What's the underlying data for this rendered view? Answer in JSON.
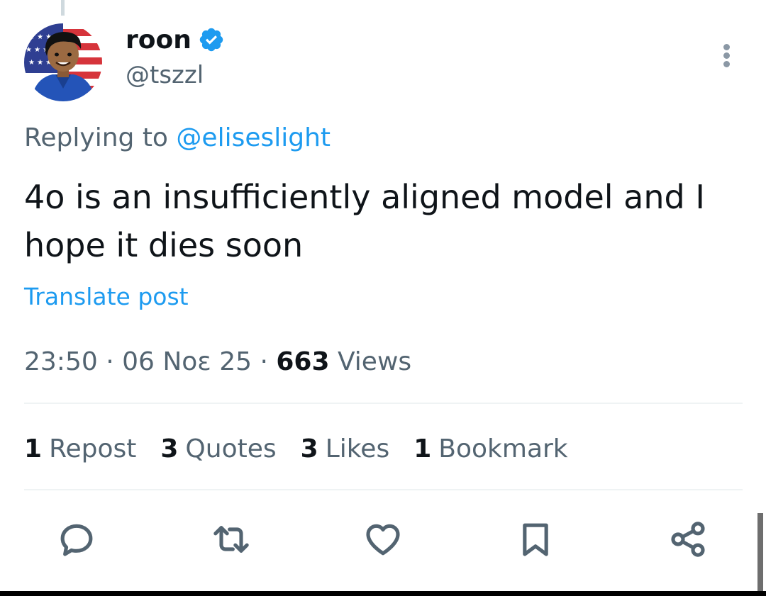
{
  "author": {
    "display_name": "roon",
    "handle": "@tszzl",
    "verified": true,
    "avatar_icon": "avatar-cartoon-flag"
  },
  "reply": {
    "prefix": "Replying to",
    "mention": "@eliseslight"
  },
  "tweet": {
    "text": "4o is an insufficiently aligned model and I hope it dies soon",
    "translate_label": "Translate post"
  },
  "meta": {
    "time": "23:50",
    "separator": " · ",
    "date": "06 Noε 25",
    "views_count": "663",
    "views_label": "Views"
  },
  "stats": [
    {
      "count": "1",
      "label": "Repost"
    },
    {
      "count": "3",
      "label": "Quotes"
    },
    {
      "count": "3",
      "label": "Likes"
    },
    {
      "count": "1",
      "label": "Bookmark"
    }
  ],
  "actions": [
    {
      "name": "reply-icon"
    },
    {
      "name": "repost-icon"
    },
    {
      "name": "like-icon"
    },
    {
      "name": "bookmark-icon"
    },
    {
      "name": "share-icon"
    }
  ],
  "colors": {
    "accent": "#1d9bf0",
    "text_primary": "#0f1419",
    "text_secondary": "#536471",
    "divider": "#eff3f4"
  }
}
